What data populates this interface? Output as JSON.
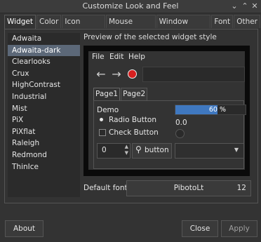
{
  "window": {
    "title": "Customize Look and Feel"
  },
  "tabs": [
    "Widget",
    "Color",
    "Icon Theme",
    "Mouse Cursor",
    "Window Border",
    "Font",
    "Other"
  ],
  "theme_list": {
    "items": [
      "Adwaita",
      "Adwaita-dark",
      "Clearlooks",
      "Crux",
      "HighContrast",
      "Industrial",
      "Mist",
      "PiX",
      "PiXflat",
      "Raleigh",
      "Redmond",
      "ThinIce"
    ],
    "selected": "Adwaita-dark"
  },
  "preview": {
    "label": "Preview of the selected widget style",
    "menus": [
      "File",
      "Edit",
      "Help"
    ],
    "tabs": [
      "Page1",
      "Page2"
    ],
    "demo_label": "Demo",
    "progress_text": "60 %",
    "progress_value": 0.6,
    "radio_label": "Radio Button",
    "value_text": "0.0",
    "check_label": "Check Button",
    "spin_value": "0",
    "button_label": "button"
  },
  "font": {
    "label": "Default font:",
    "name": "PibotoLt",
    "size": "12"
  },
  "footer": {
    "about": "About",
    "close": "Close",
    "apply": "Apply"
  },
  "colors": {
    "selection": "#5c6878",
    "progress": "#3f78c0",
    "record": "#d61f1f"
  }
}
